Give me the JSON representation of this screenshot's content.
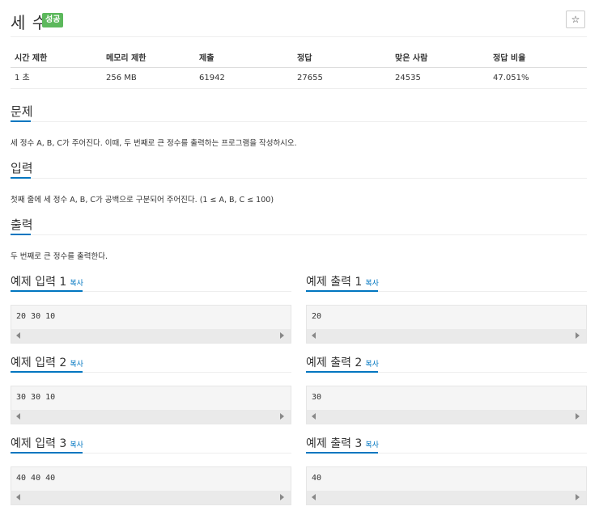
{
  "problem": {
    "title": "세 수",
    "badge": "성공",
    "star_icon": "☆"
  },
  "limits": {
    "headers": [
      "시간 제한",
      "메모리 제한",
      "제출",
      "정답",
      "맞은 사람",
      "정답 비율"
    ],
    "values": [
      "1 초",
      "256 MB",
      "61942",
      "27655",
      "24535",
      "47.051%"
    ]
  },
  "sections": {
    "description": {
      "title": "문제",
      "text": "세 정수 A, B, C가 주어진다. 이때, 두 번째로 큰 정수를 출력하는 프로그램을 작성하시오."
    },
    "input": {
      "title": "입력",
      "text": "첫째 줄에 세 정수 A, B, C가 공백으로 구분되어 주어진다. (1 ≤ A, B, C ≤ 100)"
    },
    "output": {
      "title": "출력",
      "text": "두 번째로 큰 정수를 출력한다."
    }
  },
  "examples": {
    "copy_label": "복사",
    "inputs": [
      {
        "title": "예제 입력 1",
        "content": "20 30 10"
      },
      {
        "title": "예제 입력 2",
        "content": "30 30 10"
      },
      {
        "title": "예제 입력 3",
        "content": "40 40 40"
      }
    ],
    "outputs": [
      {
        "title": "예제 출력 1",
        "content": "20"
      },
      {
        "title": "예제 출력 2",
        "content": "30"
      },
      {
        "title": "예제 출력 3",
        "content": "40"
      }
    ]
  },
  "colors": {
    "accent": "#0076c0",
    "success": "#5cb85c"
  }
}
